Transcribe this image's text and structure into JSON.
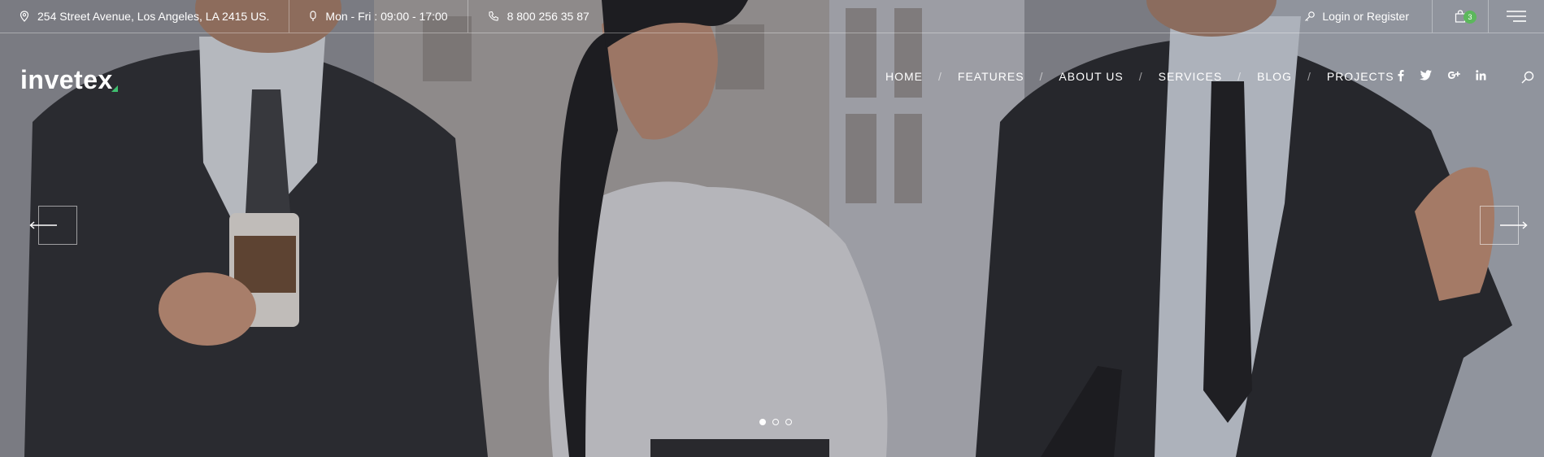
{
  "topbar": {
    "address": "254 Street Avenue, Los Angeles, LA 2415 US.",
    "hours": "Mon - Fri : 09:00 - 17:00",
    "phone": "8 800 256 35 87",
    "login": "Login or Register",
    "cart_count": "3"
  },
  "header": {
    "logo": "invetex",
    "nav": [
      "HOME",
      "FEATURES",
      "ABOUT US",
      "SERVICES",
      "BLOG",
      "PROJECTS"
    ]
  },
  "social": [
    "facebook-icon",
    "twitter-icon",
    "google-plus-icon",
    "linkedin-icon"
  ],
  "slider": {
    "slides": 3,
    "active": 1
  },
  "colors": {
    "accent": "#3fbf6f",
    "badge": "#5cb85c"
  }
}
